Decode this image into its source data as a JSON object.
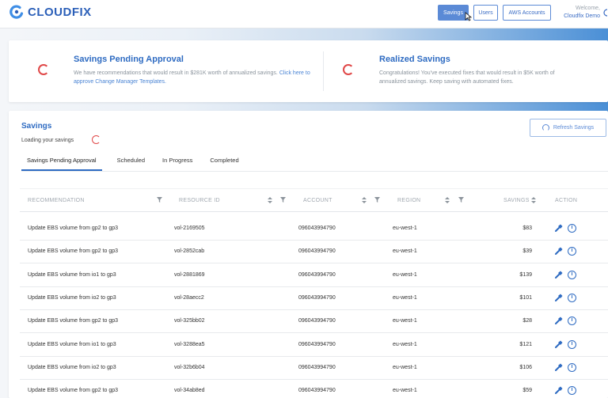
{
  "app": {
    "brand": "CLOUDFIX"
  },
  "nav": {
    "savings_label": "Savings",
    "users_label": "Users",
    "aws_label": "AWS Accounts",
    "welcome_label": "Welcome,",
    "user_name": "Cloudfix Demo"
  },
  "summary": {
    "pending_title": "Savings Pending Approval",
    "pending_desc": "We have recommendations that would result in $281K worth of annualized savings.",
    "pending_link": "Click here to approve Change Manager Templates.",
    "realized_title": "Realized Savings",
    "realized_desc_1": "Congratulations! You've executed fixes that would result in $5K worth of",
    "realized_desc_2": "annualized savings. Keep saving with automated fixes."
  },
  "savings": {
    "title": "Savings",
    "loading": "Loading your savings",
    "refresh_label": "Refresh Savings"
  },
  "tabs": [
    "Savings Pending Approval",
    "Scheduled",
    "In Progress",
    "Completed"
  ],
  "table": {
    "headers": {
      "recommendation": "RECOMMENDATION",
      "resource": "RESOURCE ID",
      "account": "ACCOUNT",
      "region": "REGION",
      "savings": "SAVINGS",
      "action": "ACTION"
    },
    "rows": [
      {
        "rec": "Update EBS volume from gp2 to gp3",
        "res": "vol-2169505",
        "acct": "096043994790",
        "region": "eu-west-1",
        "amt": "$83"
      },
      {
        "rec": "Update EBS volume from gp2 to gp3",
        "res": "vol-2852cab",
        "acct": "096043994790",
        "region": "eu-west-1",
        "amt": "$39"
      },
      {
        "rec": "Update EBS volume from io1 to gp3",
        "res": "vol-2881869",
        "acct": "096043994790",
        "region": "eu-west-1",
        "amt": "$139"
      },
      {
        "rec": "Update EBS volume from io2 to gp3",
        "res": "vol-28aecc2",
        "acct": "096043994790",
        "region": "eu-west-1",
        "amt": "$101"
      },
      {
        "rec": "Update EBS volume from gp2 to gp3",
        "res": "vol-325bb02",
        "acct": "096043994790",
        "region": "eu-west-1",
        "amt": "$28"
      },
      {
        "rec": "Update EBS volume from io1 to gp3",
        "res": "vol-3288ea5",
        "acct": "096043994790",
        "region": "eu-west-1",
        "amt": "$121"
      },
      {
        "rec": "Update EBS volume from io2 to gp3",
        "res": "vol-32b6b04",
        "acct": "096043994790",
        "region": "eu-west-1",
        "amt": "$106"
      },
      {
        "rec": "Update EBS volume from gp2 to gp3",
        "res": "vol-34ab8ed",
        "acct": "096043994790",
        "region": "eu-west-1",
        "amt": "$59"
      }
    ]
  },
  "colors": {
    "brand": "#2b5fb8",
    "accent": "#5b8ad6",
    "spinner": "#e04848"
  }
}
